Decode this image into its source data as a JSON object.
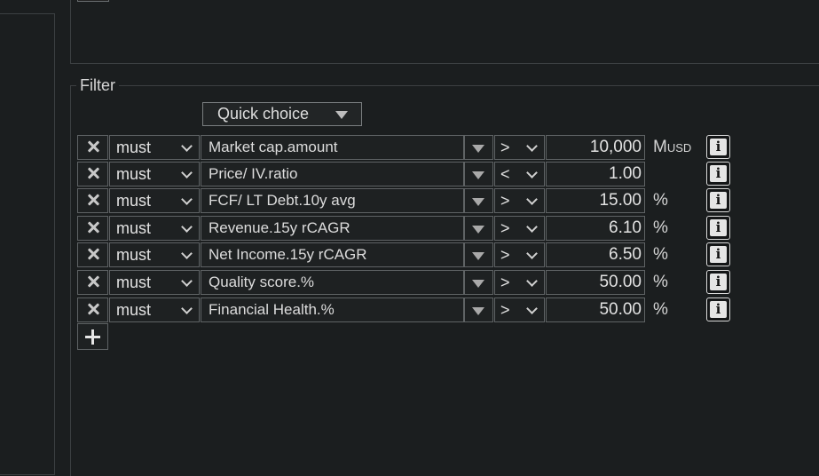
{
  "filter": {
    "legend": "Filter",
    "quick_choice_label": "Quick choice",
    "rows": [
      {
        "condition": "must",
        "field": "Market cap.amount",
        "operator": ">",
        "value": "10,000",
        "unit_main": "M",
        "unit_small": "USD"
      },
      {
        "condition": "must",
        "field": "Price/ IV.ratio",
        "operator": "<",
        "value": "1.00",
        "unit_main": "",
        "unit_small": ""
      },
      {
        "condition": "must",
        "field": "FCF/ LT Debt.10y avg",
        "operator": ">",
        "value": "15.00",
        "unit_main": "%",
        "unit_small": ""
      },
      {
        "condition": "must",
        "field": "Revenue.15y rCAGR",
        "operator": ">",
        "value": "6.10",
        "unit_main": "%",
        "unit_small": ""
      },
      {
        "condition": "must",
        "field": "Net Income.15y rCAGR",
        "operator": ">",
        "value": "6.50",
        "unit_main": "%",
        "unit_small": ""
      },
      {
        "condition": "must",
        "field": "Quality score.%",
        "operator": ">",
        "value": "50.00",
        "unit_main": "%",
        "unit_small": ""
      },
      {
        "condition": "must",
        "field": "Financial Health.%",
        "operator": ">",
        "value": "50.00",
        "unit_main": "%",
        "unit_small": ""
      }
    ],
    "icons": {
      "remove": "close-icon",
      "field_dropdown": "triangle-down-icon",
      "select": "chevron-down-icon",
      "info": "info-icon",
      "add": "plus-icon"
    },
    "info_glyph": "i"
  }
}
